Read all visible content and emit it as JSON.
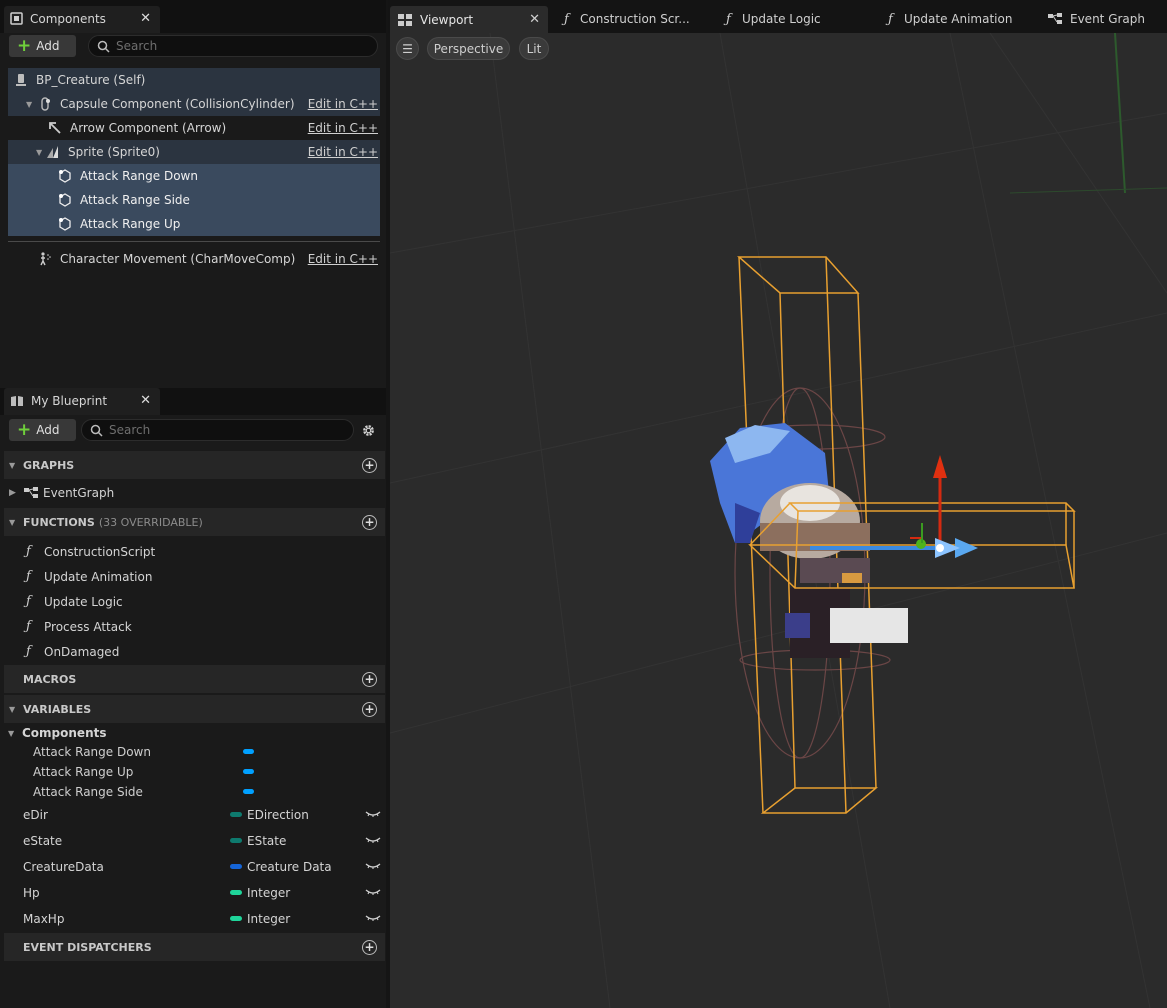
{
  "components_panel": {
    "title": "Components",
    "add_label": "Add",
    "search_placeholder": "Search",
    "tree": [
      {
        "label": "BP_Creature (Self)",
        "edit": ""
      },
      {
        "label": "Capsule Component (CollisionCylinder)",
        "edit": "Edit in C++"
      },
      {
        "label": "Arrow Component (Arrow)",
        "edit": "Edit in C++"
      },
      {
        "label": "Sprite (Sprite0)",
        "edit": "Edit in C++"
      },
      {
        "label": "Attack Range Down",
        "edit": ""
      },
      {
        "label": "Attack Range Side",
        "edit": ""
      },
      {
        "label": "Attack Range Up",
        "edit": ""
      },
      {
        "label": "Character Movement (CharMoveComp)",
        "edit": "Edit in C++"
      }
    ]
  },
  "blueprint_panel": {
    "title": "My Blueprint",
    "add_label": "Add",
    "search_placeholder": "Search",
    "sections": {
      "graphs": "GRAPHS",
      "functions": "FUNCTIONS",
      "functions_sub": "(33 OVERRIDABLE)",
      "macros": "MACROS",
      "variables": "VARIABLES",
      "dispatchers": "EVENT DISPATCHERS"
    },
    "graphs": [
      "EventGraph"
    ],
    "functions": [
      "ConstructionScript",
      "Update Animation",
      "Update Logic",
      "Process Attack",
      "OnDamaged"
    ],
    "variable_category": "Components",
    "component_vars": [
      "Attack Range Down",
      "Attack Range Up",
      "Attack Range Side"
    ],
    "typed_vars": [
      {
        "name": "eDir",
        "type": "EDirection",
        "color": "#0e7a6e"
      },
      {
        "name": "eState",
        "type": "EState",
        "color": "#0e7a6e"
      },
      {
        "name": "CreatureData",
        "type": "Creature Data",
        "color": "#1565d8"
      },
      {
        "name": "Hp",
        "type": "Integer",
        "color": "#1fd59a"
      },
      {
        "name": "MaxHp",
        "type": "Integer",
        "color": "#1fd59a"
      }
    ]
  },
  "top_tabs": [
    "Viewport",
    "Construction Scr...",
    "Update Logic",
    "Update Animation",
    "Event Graph"
  ],
  "viewport": {
    "perspective_label": "Perspective",
    "lit_label": "Lit"
  }
}
